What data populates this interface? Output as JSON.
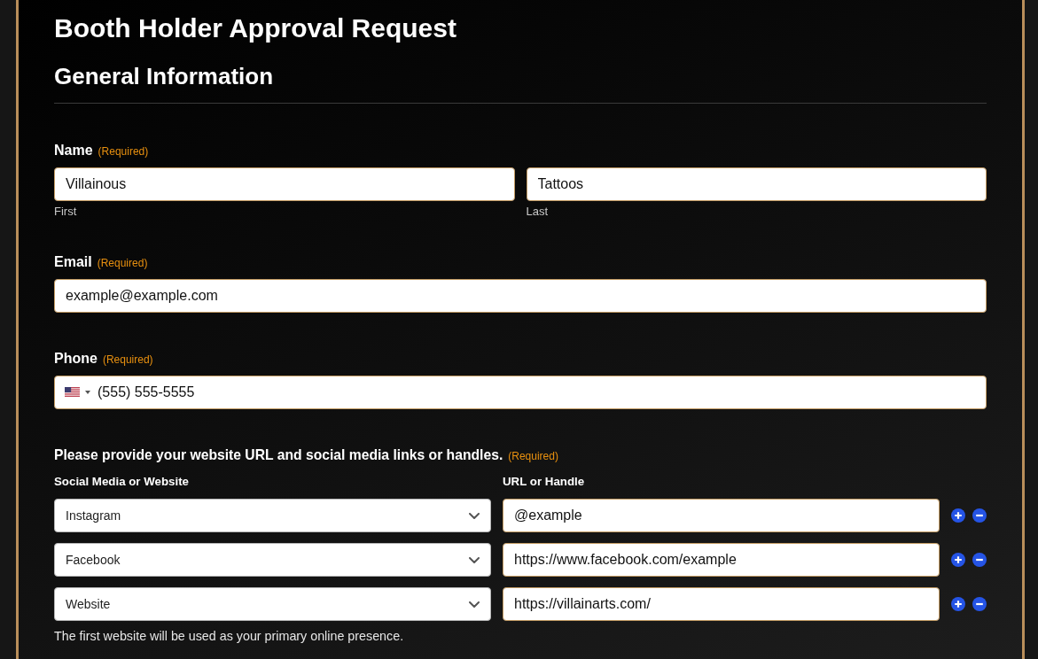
{
  "title": "Booth Holder Approval Request",
  "section": {
    "heading": "General Information"
  },
  "fields": [
    {
      "kind": "name",
      "label": "Name",
      "required_note": "(Required)",
      "parts": [
        {
          "value": "Villainous",
          "sublabel": "First"
        },
        {
          "value": "Tattoos",
          "sublabel": "Last"
        }
      ]
    },
    {
      "kind": "email",
      "label": "Email",
      "required_note": "(Required)",
      "value": "example@example.com"
    },
    {
      "kind": "phone",
      "label": "Phone",
      "required_note": "(Required)",
      "value": "(555) 555-5555"
    },
    {
      "kind": "links",
      "label": "Please provide your website URL and social media links or handles.",
      "required_note": "(Required)",
      "columns": [
        "Social Media or Website",
        "URL or Handle"
      ],
      "rows": [
        {
          "platform": "Instagram",
          "url": "@example"
        },
        {
          "platform": "Facebook",
          "url": "https://www.facebook.com/example"
        },
        {
          "platform": "Website",
          "url": "https://villainarts.com/"
        }
      ],
      "note": "The first website will be used as your primary online presence."
    }
  ]
}
